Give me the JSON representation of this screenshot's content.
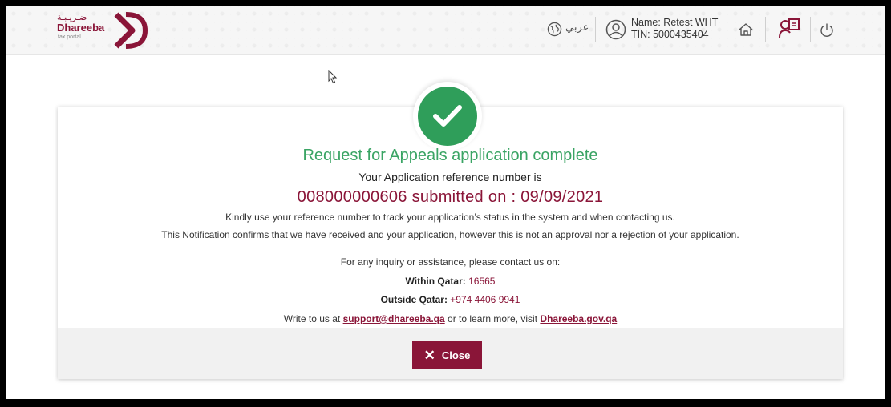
{
  "header": {
    "logo_arabic": "ضـريـبـة",
    "logo_name": "Dhareeba",
    "logo_sub": "tax portal",
    "language_label": "عربي",
    "user_name": "Name: Retest WHT",
    "user_tin": "TIN: 5000435404",
    "icons": [
      "globe-icon",
      "user-circle-icon",
      "home-icon",
      "profile-icon",
      "power-icon"
    ]
  },
  "result": {
    "title": "Request for Appeals application complete",
    "ref_intro": "Your Application reference number is",
    "ref_line": "008000000606 submitted on : 09/09/2021",
    "note_1": "Kindly use your reference number to track your application’s status in the system and when contacting us.",
    "note_2": "This Notification confirms that we have received and your application, however this is not an approval nor a rejection of your application.",
    "contact_intro": "For any inquiry or assistance, please contact us on:",
    "within_label": "Within Qatar:",
    "within_phone": "16565",
    "outside_label": "Outside Qatar:",
    "outside_phone": "+974 4406 9941",
    "write_prefix": "Write to us at",
    "email": "support@dhareeba.qa",
    "write_middle": "or to learn more, visit",
    "website": "Dhareeba.gov.qa"
  },
  "footer": {
    "close_label": "Close"
  },
  "colors": {
    "brand": "#8a1538",
    "success": "#3aa464"
  }
}
